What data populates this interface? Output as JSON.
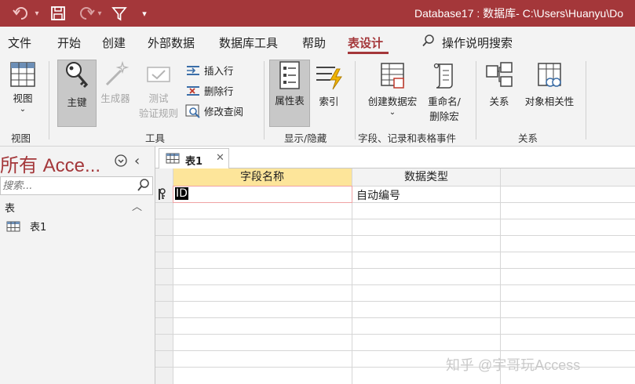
{
  "window": {
    "title": "Database17 : 数据库- C:\\Users\\Huanyu\\Do"
  },
  "tabs": [
    {
      "label": "文件"
    },
    {
      "label": "开始"
    },
    {
      "label": "创建"
    },
    {
      "label": "外部数据"
    },
    {
      "label": "数据库工具"
    },
    {
      "label": "帮助"
    },
    {
      "label": "表设计",
      "active": true
    }
  ],
  "tell_me": {
    "label": "操作说明搜索"
  },
  "ribbon": {
    "view": {
      "label": "视图",
      "group": "视图"
    },
    "tools": {
      "primary_key": "主键",
      "builder": "生成器",
      "test_rules": [
        "测试",
        "验证规则"
      ],
      "insert_row": "插入行",
      "delete_row": "删除行",
      "modify_lookup": "修改查阅",
      "group": "工具"
    },
    "show_hide": {
      "property_sheet": "属性表",
      "index": "索引",
      "group": "显示/隐藏"
    },
    "events": {
      "create_macro": "创建数据宏",
      "rename_macro": [
        "重命名/",
        "删除宏"
      ],
      "group": "字段、记录和表格事件"
    },
    "relations": {
      "relations": "关系",
      "dependencies": "对象相关性",
      "group": "关系"
    }
  },
  "nav": {
    "header": "所有 Acce...",
    "search_placeholder": "搜索...",
    "category": "表",
    "items": [
      {
        "label": "表1"
      }
    ]
  },
  "document": {
    "tab_label": "表1",
    "columns": [
      "字段名称",
      "数据类型"
    ],
    "rows": [
      {
        "field": "ID",
        "type": "自动编号",
        "primary_key": true
      }
    ]
  },
  "watermark": "知乎 @宇哥玩Access",
  "colors": {
    "accent": "#a4373a",
    "header_highlight": "#fde59a",
    "ribbon_bg": "#f3f3f3"
  }
}
